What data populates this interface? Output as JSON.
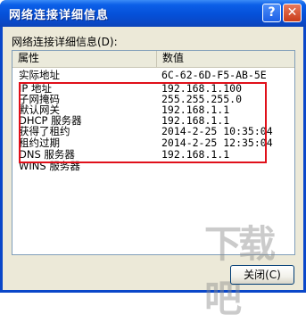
{
  "window": {
    "title": "网络连接详细信息",
    "help_glyph": "?",
    "close_glyph": "✕"
  },
  "group_label": "网络连接详细信息(D):",
  "table": {
    "columns": [
      "属性",
      "数值"
    ],
    "rows": [
      {
        "property": "实际地址",
        "value": "6C-62-6D-F5-AB-5E"
      },
      {
        "property": "IP 地址",
        "value": "192.168.1.100"
      },
      {
        "property": "子网掩码",
        "value": "255.255.255.0"
      },
      {
        "property": "默认网关",
        "value": "192.168.1.1"
      },
      {
        "property": "DHCP 服务器",
        "value": "192.168.1.1"
      },
      {
        "property": "获得了租约",
        "value": "2014-2-25 10:35:04"
      },
      {
        "property": "租约过期",
        "value": "2014-2-25 12:35:04"
      },
      {
        "property": "DNS 服务器",
        "value": "192.168.1.1"
      },
      {
        "property": "WINS 服务器",
        "value": ""
      }
    ]
  },
  "buttons": {
    "close_label": "关闭(C)"
  },
  "watermark": "下载吧",
  "colors": {
    "titlebar": "#0550d8",
    "highlight_border": "#e0101a",
    "dialog_bg": "#ece9d8"
  }
}
